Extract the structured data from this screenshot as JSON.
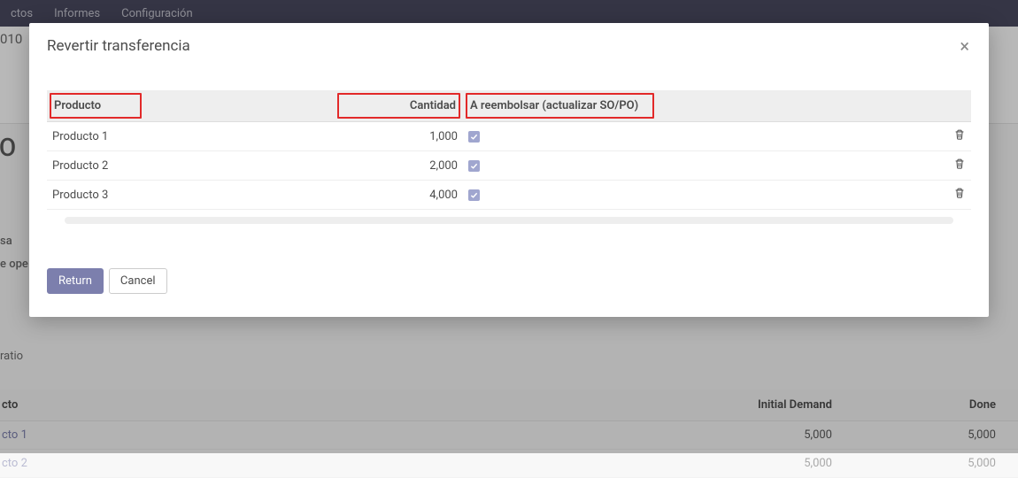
{
  "nav": {
    "items": [
      "ctos",
      "Informes",
      "Configuración"
    ]
  },
  "background": {
    "ref_top": "010",
    "title_cut": "I/O",
    "info_line1": "sa",
    "info_line2": "e ope",
    "tab_label": "ratio",
    "table": {
      "col_product": "cto",
      "col_demand": "Initial Demand",
      "col_done": "Done",
      "rows": [
        {
          "product": "cto 1",
          "demand": "5,000",
          "done": "5,000"
        },
        {
          "product": "cto 2",
          "demand": "5,000",
          "done": "5,000"
        }
      ]
    }
  },
  "modal": {
    "title": "Revertir transferencia",
    "columns": {
      "product": "Producto",
      "quantity": "Cantidad",
      "refund": "A reembolsar (actualizar SO/PO)"
    },
    "rows": [
      {
        "product": "Producto 1",
        "quantity": "1,000",
        "refund": true
      },
      {
        "product": "Producto 2",
        "quantity": "2,000",
        "refund": true
      },
      {
        "product": "Producto 3",
        "quantity": "4,000",
        "refund": true
      }
    ],
    "buttons": {
      "return": "Return",
      "cancel": "Cancel"
    }
  }
}
